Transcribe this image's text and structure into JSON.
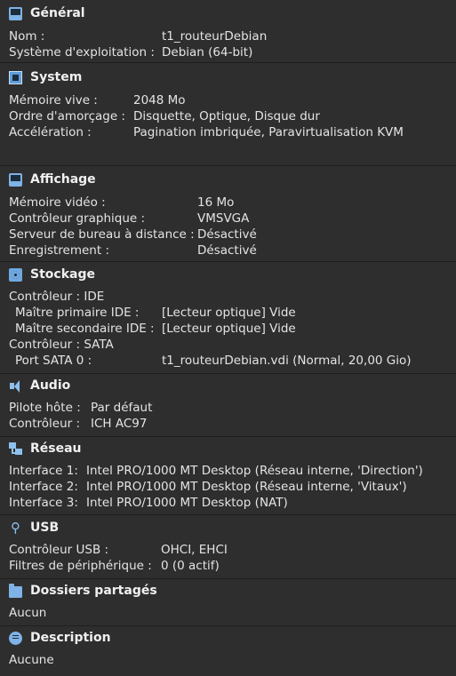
{
  "sections": {
    "general": {
      "title": "Général",
      "icon": "monitor-icon",
      "rows": [
        {
          "label": "Nom :",
          "value": "t1_routeurDebian"
        },
        {
          "label": "Système d'exploitation :",
          "value": "Debian (64-bit)"
        }
      ]
    },
    "system": {
      "title": "System",
      "icon": "chip-icon",
      "rows": [
        {
          "label": "Mémoire vive :",
          "value": "2048 Mo"
        },
        {
          "label": "Ordre d'amorçage :",
          "value": "Disquette, Optique, Disque dur"
        },
        {
          "label": "Accélération :",
          "value": "Pagination imbriquée, Paravirtualisation KVM"
        }
      ]
    },
    "display": {
      "title": "Affichage",
      "icon": "monitor-icon",
      "rows": [
        {
          "label": "Mémoire vidéo :",
          "value": "16 Mo"
        },
        {
          "label": "Contrôleur graphique :",
          "value": "VMSVGA"
        },
        {
          "label": "Serveur de bureau à distance :",
          "value": "Désactivé"
        },
        {
          "label": "Enregistrement :",
          "value": "Désactivé"
        }
      ]
    },
    "storage": {
      "title": "Stockage",
      "icon": "disk-icon",
      "rows": [
        {
          "label": "Contrôleur : IDE",
          "value": ""
        },
        {
          "label": "Maître primaire IDE :",
          "value": "[Lecteur optique] Vide"
        },
        {
          "label": "Maître secondaire IDE :",
          "value": "[Lecteur optique] Vide"
        },
        {
          "label": "Contrôleur : SATA",
          "value": ""
        },
        {
          "label": "Port SATA 0 :",
          "value": "t1_routeurDebian.vdi (Normal, 20,00 Gio)"
        }
      ]
    },
    "audio": {
      "title": "Audio",
      "icon": "speaker-icon",
      "rows": [
        {
          "label": "Pilote hôte :",
          "value": "Par défaut"
        },
        {
          "label": "Contrôleur :",
          "value": "ICH AC97"
        }
      ]
    },
    "network": {
      "title": "Réseau",
      "icon": "network-icon",
      "rows": [
        {
          "label": "Interface 1:",
          "value": "Intel PRO/1000 MT Desktop (Réseau interne, 'Direction')"
        },
        {
          "label": "Interface 2:",
          "value": "Intel PRO/1000 MT Desktop (Réseau interne, 'Vitaux')"
        },
        {
          "label": "Interface 3:",
          "value": "Intel PRO/1000 MT Desktop (NAT)"
        }
      ]
    },
    "usb": {
      "title": "USB",
      "icon": "usb-icon",
      "rows": [
        {
          "label": "Contrôleur USB :",
          "value": "OHCI, EHCI"
        },
        {
          "label": "Filtres de périphérique :",
          "value": "0 (0 actif)"
        }
      ]
    },
    "shared": {
      "title": "Dossiers partagés",
      "icon": "folder-icon",
      "rows": [
        {
          "label": "Aucun",
          "value": ""
        }
      ]
    },
    "description": {
      "title": "Description",
      "icon": "speech-bubble-icon",
      "rows": [
        {
          "label": "Aucune",
          "value": ""
        }
      ]
    }
  }
}
